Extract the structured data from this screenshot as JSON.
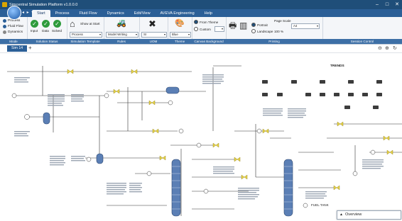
{
  "window": {
    "title": "Simcentral Simulation Platform v1.0.0.0",
    "min": "–",
    "max": "□",
    "close": "✕"
  },
  "quick_access": "◂ ▸ ▾",
  "tabs": [
    "Start",
    "Process",
    "Fluid Flow",
    "Dynamics",
    "Edit/View",
    "AVEVA Engineering",
    "Help"
  ],
  "ribbon": {
    "mode": {
      "items": [
        "Process",
        "Fluid Flow",
        "Dynamics"
      ],
      "label": "Mode"
    },
    "solution_status": {
      "items": [
        "Input",
        "Data",
        "Solved"
      ],
      "label": "Solution Status"
    },
    "simulation_template": {
      "show_at_start": "Show at Start",
      "process_value": "Process",
      "label": "Simulation Template"
    },
    "rules": {
      "value": "Model Writing",
      "label": "Rules"
    },
    "uom": {
      "value": "SI",
      "label": "UOM"
    },
    "theme": {
      "value": "Blue",
      "label": "Theme"
    },
    "canvas_background": {
      "from_theme": "From Theme",
      "custom": "Custom",
      "label": "Canvas Background"
    },
    "printing": {
      "portrait": "Portrait",
      "landscape": "Landscape",
      "page_scale": "Page Scale",
      "page_scale_value": "100 %",
      "paper": "A4",
      "label": "Printing"
    },
    "session_control": {
      "label": "Session Control"
    }
  },
  "document": {
    "tab": "Sim 14",
    "add": "+",
    "zoom_in": "⊕",
    "zoom_out": "⊖",
    "refresh": "↻"
  },
  "canvas": {
    "trends_title": "TRENDS",
    "fuel_label": "FUEL TANK"
  },
  "overview": {
    "label": "Overview",
    "caret": "▲"
  },
  "colors": {
    "accent": "#2b5f97",
    "title_bar": "#1f4e79",
    "vessel": "#5b7fb5",
    "pipe": "#333333",
    "valve": "#e6d34a",
    "solved": "#2e9b3c"
  }
}
